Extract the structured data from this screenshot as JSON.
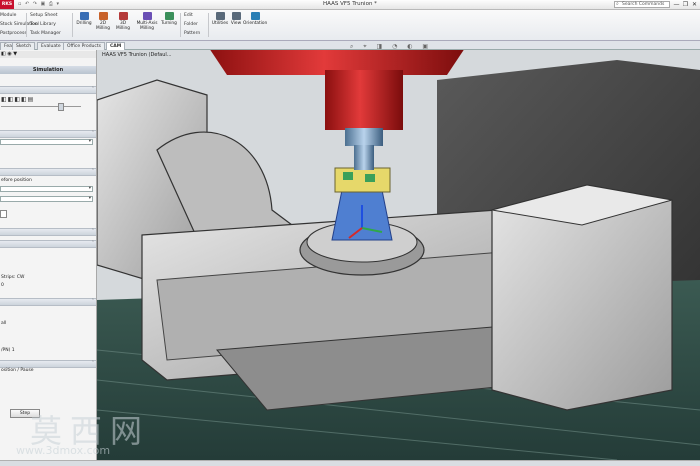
{
  "window": {
    "title": "HAAS VF5 Trunion *",
    "logo": "RKS",
    "search_placeholder": "Search Commands",
    "controls": [
      "—",
      "❐",
      "✕"
    ]
  },
  "ribbon": {
    "left_items": [
      "Module",
      "Stock Simulation",
      "Postprocess"
    ],
    "small_items": [
      "Setup Sheet",
      "Tool Library",
      "Task Manager"
    ],
    "buttons": [
      {
        "label": "Drilling",
        "icon": "drilling-icon",
        "color": "#3a6fb5"
      },
      {
        "label": "2D Milling",
        "icon": "2d-milling-icon",
        "color": "#c8622a"
      },
      {
        "label": "3D Milling",
        "icon": "3d-milling-icon",
        "color": "#b53a3a"
      },
      {
        "label": "Multi-Axis Milling",
        "icon": "multi-axis-icon",
        "color": "#6a4fb5"
      },
      {
        "label": "Turning",
        "icon": "turning-icon",
        "color": "#3a8f5a"
      },
      {
        "label": "Utilities",
        "icon": "utilities-icon",
        "color": "#5a6a7a"
      },
      {
        "label": "View",
        "icon": "view-icon",
        "color": "#5a6a7a"
      },
      {
        "label": "Orientation",
        "icon": "orientation-icon",
        "color": "#2a7fb5"
      }
    ],
    "mid_items": [
      "Edit",
      "Folder",
      "Pattern"
    ]
  },
  "tabs": [
    {
      "label": "Feature",
      "active": false
    },
    {
      "label": "Sketch",
      "active": false
    },
    {
      "label": "Evaluate",
      "active": false
    },
    {
      "label": "Office Products",
      "active": false
    },
    {
      "label": "CAM",
      "active": true
    }
  ],
  "tree": {
    "label": "HAAS VF5 Trunion (Defaul..."
  },
  "panel": {
    "header": "Simulation",
    "field_before_position": "efore position",
    "text_strips": "Strips: CW",
    "text_all": "all",
    "text_pn": "/PN) 1",
    "text_position": "osition / Pause",
    "step_button": "Step"
  },
  "watermark": {
    "text": "莫西网",
    "url": "www.3dmox.com"
  }
}
